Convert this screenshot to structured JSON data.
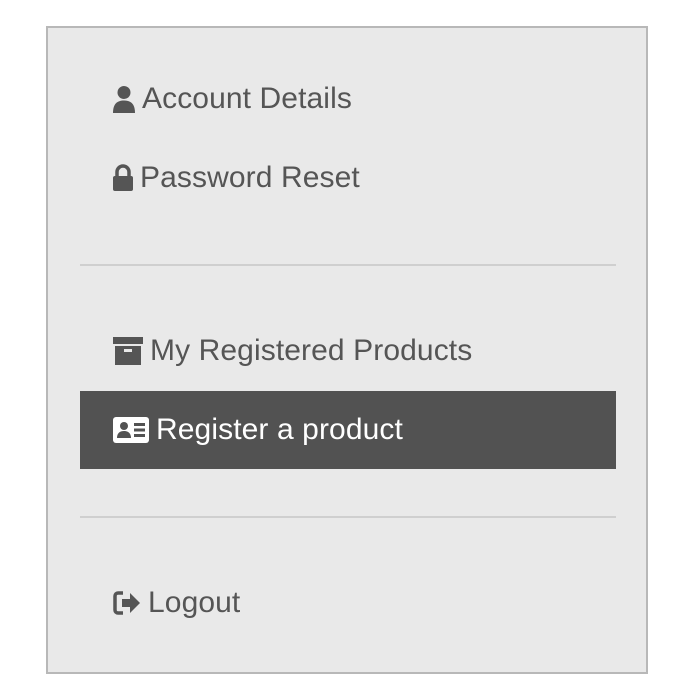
{
  "menu": {
    "account_details": {
      "label": "Account Details",
      "icon": "user-icon"
    },
    "password_reset": {
      "label": "Password Reset",
      "icon": "lock-icon"
    },
    "my_registered_products": {
      "label": "My Registered Products",
      "icon": "archive-icon"
    },
    "register_product": {
      "label": "Register a product",
      "icon": "id-card-icon",
      "active": true
    },
    "logout": {
      "label": "Logout",
      "icon": "sign-out-icon"
    }
  },
  "colors": {
    "panel_bg": "#e9e9e9",
    "panel_border": "#b8b8b8",
    "text": "#555555",
    "active_bg": "#525252",
    "active_text": "#ffffff",
    "divider": "#cfcfcf"
  }
}
